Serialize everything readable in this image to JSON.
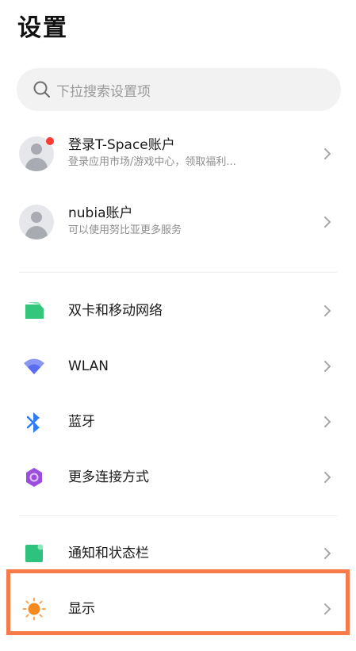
{
  "header": {
    "title": "设置"
  },
  "search": {
    "placeholder": "下拉搜索设置项"
  },
  "accounts": [
    {
      "title": "登录T-Space账户",
      "subtitle": "登录应用市场/游戏中心，领取福利..."
    },
    {
      "title": "nubia账户",
      "subtitle": "可以使用努比亚更多服务"
    }
  ],
  "connectivity": [
    {
      "label": "双卡和移动网络",
      "icon": "sim-card-icon"
    },
    {
      "label": "WLAN",
      "icon": "wifi-icon"
    },
    {
      "label": "蓝牙",
      "icon": "bluetooth-icon"
    },
    {
      "label": "更多连接方式",
      "icon": "more-connections-icon"
    }
  ],
  "system": [
    {
      "label": "通知和状态栏",
      "icon": "notification-icon"
    },
    {
      "label": "显示",
      "icon": "sun-icon"
    }
  ],
  "colors": {
    "sim": "#34c77b",
    "wifi": "#5b6cf0",
    "bluetooth": "#2f7cf6",
    "more": "#9b4de0",
    "notification": "#2ec27e",
    "display": "#f5891f",
    "highlight": "#f77a4b",
    "badge": "#ff3b30"
  }
}
